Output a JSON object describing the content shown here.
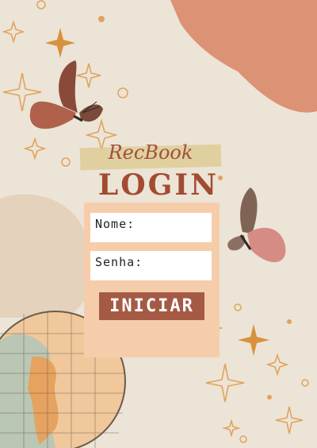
{
  "brand": "RecBook",
  "title": "LOGIN",
  "form": {
    "name_label": "Nome:",
    "password_label": "Senha:",
    "submit_label": "INICIAR"
  },
  "colors": {
    "accent": "#a24b33",
    "card": "#f6cdab",
    "button": "#a45a44",
    "background": "#ece4d6"
  }
}
